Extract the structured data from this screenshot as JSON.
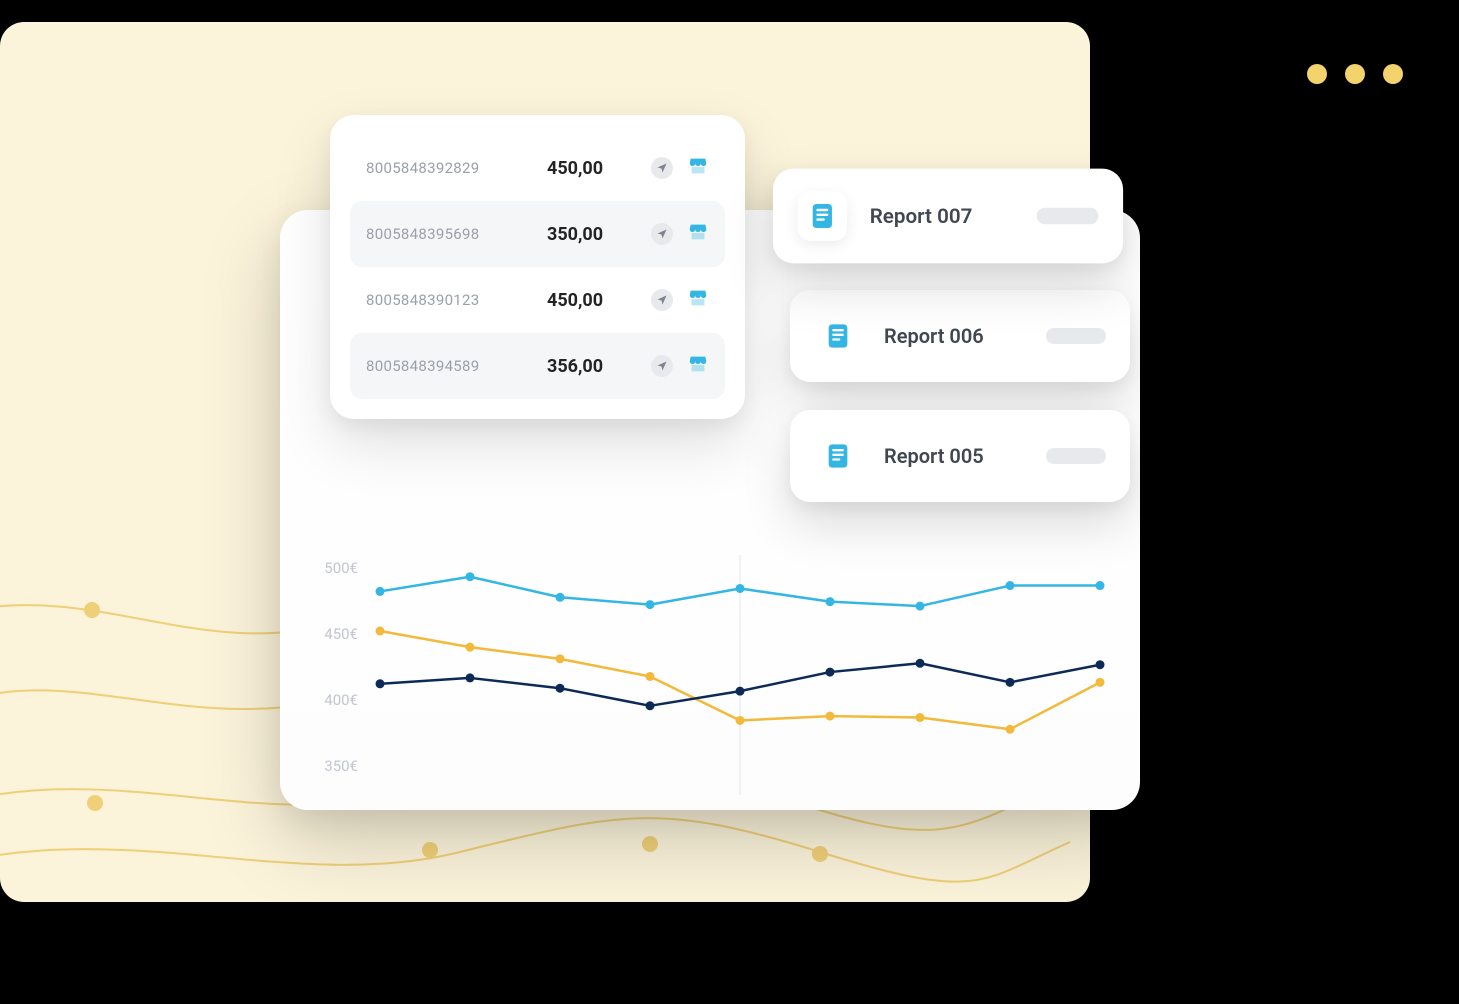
{
  "transactions": [
    {
      "id": "8005848392829",
      "amount": "450,00"
    },
    {
      "id": "8005848395698",
      "amount": "350,00"
    },
    {
      "id": "8005848390123",
      "amount": "450,00"
    },
    {
      "id": "8005848394589",
      "amount": "356,00"
    }
  ],
  "reports": [
    {
      "label": "Report 007"
    },
    {
      "label": "Report 006"
    },
    {
      "label": "Report 005"
    }
  ],
  "chart_data": {
    "type": "line",
    "ylabel": "€",
    "ylim": [
      350,
      500
    ],
    "y_ticks": [
      "500€",
      "450€",
      "400€",
      "350€"
    ],
    "x_count": 9,
    "series": [
      {
        "name": "blue",
        "color": "#34b6e4",
        "values": [
          482,
          492,
          478,
          473,
          484,
          475,
          472,
          486,
          486
        ]
      },
      {
        "name": "yellow",
        "color": "#f2b93b",
        "values": [
          455,
          444,
          436,
          424,
          394,
          397,
          396,
          388,
          420
        ]
      },
      {
        "name": "navy",
        "color": "#0d2a57",
        "values": [
          419,
          423,
          416,
          404,
          414,
          427,
          433,
          420,
          432
        ]
      }
    ]
  },
  "colors": {
    "cream": "#fbf3da",
    "accent": "#34b6e4"
  }
}
